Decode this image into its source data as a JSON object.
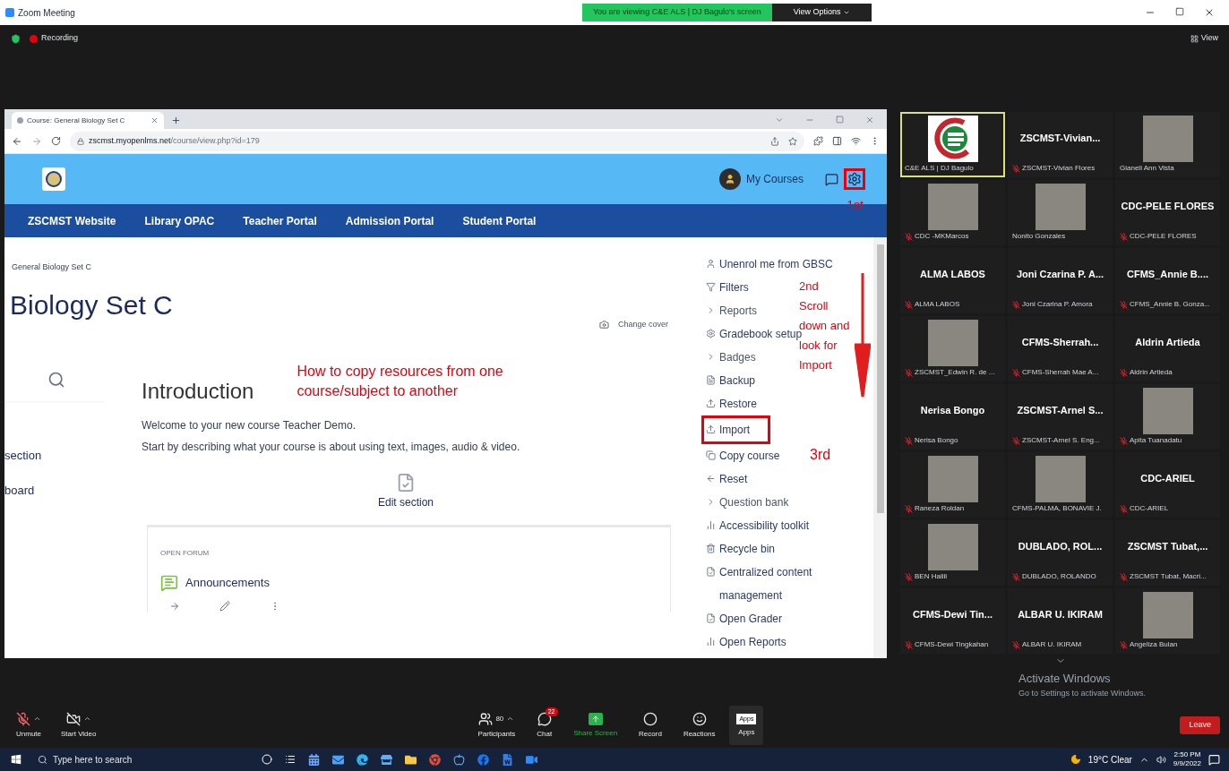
{
  "titlebar": {
    "title": "Zoom Meeting",
    "banner": "You are viewing C&E ALS | DJ Bagulo's screen",
    "view_options": "View Options"
  },
  "statusbar": {
    "recording": "Recording",
    "view": "View"
  },
  "browser": {
    "tab": "Course: General Biology Set C",
    "url_host": "zscmst.myopenlms.net",
    "url_path": "/course/view.php?id=179",
    "my_courses": "My Courses",
    "nav": [
      "ZSCMST Website",
      "Library OPAC",
      "Teacher Portal",
      "Admission Portal",
      "Student Portal"
    ],
    "breadcrumb": "General Biology Set C",
    "title": "Biology Set C",
    "change_cover": "Change cover",
    "left_links": [
      "section",
      "board"
    ],
    "section": {
      "heading": "Introduction",
      "text": [
        "Welcome to your new course Teacher Demo.",
        "Start by describing what your course is about using text, images, audio & video."
      ],
      "edit": "Edit section",
      "card_label": "OPEN FORUM",
      "activity": "Announcements"
    },
    "menu": [
      {
        "label": "Unenrol me from GBSC",
        "kind": "user",
        "highlighted": false
      },
      {
        "label": "Filters",
        "kind": "filter",
        "highlighted": false
      },
      {
        "label": "Reports",
        "kind": "chevron",
        "highlighted": false
      },
      {
        "label": "Gradebook setup",
        "kind": "gear",
        "highlighted": false
      },
      {
        "label": "Badges",
        "kind": "chevron",
        "highlighted": false
      },
      {
        "label": "Backup",
        "kind": "file",
        "highlighted": false
      },
      {
        "label": "Restore",
        "kind": "upload",
        "highlighted": false
      },
      {
        "label": "Import",
        "kind": "upload",
        "highlighted": true
      },
      {
        "label": "Copy course",
        "kind": "copy",
        "highlighted": false
      },
      {
        "label": "Reset",
        "kind": "back",
        "highlighted": false
      },
      {
        "label": "Question bank",
        "kind": "chevron",
        "highlighted": false
      },
      {
        "label": "Accessibility toolkit",
        "kind": "chart",
        "highlighted": false
      },
      {
        "label": "Recycle bin",
        "kind": "trash",
        "highlighted": false
      },
      {
        "label": "Centralized content management",
        "kind": "doc",
        "highlighted": false
      },
      {
        "label": "Open Grader",
        "kind": "doc",
        "highlighted": false
      },
      {
        "label": "Open Reports",
        "kind": "chart",
        "highlighted": false
      }
    ]
  },
  "annotations": {
    "step1": "1st",
    "step2": "2nd",
    "step2_text": "Scroll down and look for Import",
    "step3": "3rd",
    "title": "How to copy resources from one course/subject to another"
  },
  "gallery": [
    {
      "kind": "logo",
      "name": "C&E ALS | DJ Bagulo",
      "muted": false,
      "active": true
    },
    {
      "kind": "name",
      "label": "ZSCMST-Vivian...",
      "name": "ZSCMST-Vivian Flores",
      "muted": true,
      "active": false
    },
    {
      "kind": "photo",
      "name": "Gianeli Ann Vista",
      "muted": false,
      "active": false
    },
    {
      "kind": "photo",
      "name": "CDC -MKMarcos",
      "muted": true,
      "active": false
    },
    {
      "kind": "photo",
      "name": "Nonito Gonzales",
      "muted": false,
      "active": false
    },
    {
      "kind": "name",
      "label": "CDC-PELE FLORES",
      "name": "CDC-PELE FLORES",
      "muted": true,
      "active": false
    },
    {
      "kind": "name",
      "label": "ALMA LABOS",
      "name": "ALMA LABOS",
      "muted": true,
      "active": false
    },
    {
      "kind": "name",
      "label": "Joni Czarina P. A...",
      "name": "Joni Czarina P. Amora",
      "muted": true,
      "active": false
    },
    {
      "kind": "name",
      "label": "CFMS_Annie B....",
      "name": "CFMS_Annie B. Gonza...",
      "muted": true,
      "active": false
    },
    {
      "kind": "photo",
      "name": "ZSCMST_Edwin R. de ...",
      "muted": true,
      "active": false
    },
    {
      "kind": "name",
      "label": "CFMS-Sherrah...",
      "name": "CFMS-Sherrah Mae A...",
      "muted": true,
      "active": false
    },
    {
      "kind": "name",
      "label": "Aldrin Artieda",
      "name": "Aldrin Artieda",
      "muted": true,
      "active": false
    },
    {
      "kind": "name",
      "label": "Nerisa Bongo",
      "name": "Nerisa Bongo",
      "muted": true,
      "active": false
    },
    {
      "kind": "name",
      "label": "ZSCMST-Arnel S...",
      "name": "ZSCMST-Arnel S. Eng...",
      "muted": true,
      "active": false
    },
    {
      "kind": "photo",
      "name": "Apita Tuanadatu",
      "muted": true,
      "active": false
    },
    {
      "kind": "photo",
      "name": "Raneza Roldan",
      "muted": true,
      "active": false
    },
    {
      "kind": "photo",
      "name": "CFMS-PALMA, BONAVIE J.",
      "muted": false,
      "active": false
    },
    {
      "kind": "name",
      "label": "CDC-ARIEL",
      "name": "CDC-ARIEL",
      "muted": true,
      "active": false
    },
    {
      "kind": "photo",
      "name": "BEN Halili",
      "muted": true,
      "active": false
    },
    {
      "kind": "name",
      "label": "DUBLADO, ROL...",
      "name": "DUBLADO, ROLANDO",
      "muted": true,
      "active": false
    },
    {
      "kind": "name",
      "label": "ZSCMST Tubat,...",
      "name": "ZSCMST Tubat, Macri...",
      "muted": true,
      "active": false
    },
    {
      "kind": "name",
      "label": "CFMS-Dewi Tin...",
      "name": "CFMS-Dewi Tingkahan",
      "muted": true,
      "active": false
    },
    {
      "kind": "name",
      "label": "ALBAR U. IKIRAM",
      "name": "ALBAR U. IKIRAM",
      "muted": true,
      "active": false
    },
    {
      "kind": "photo",
      "name": "Angeliza Bulan",
      "muted": true,
      "active": false
    }
  ],
  "activation": {
    "title": "Activate Windows",
    "text": "Go to Settings to activate Windows."
  },
  "toolbar": [
    {
      "kind": "mic",
      "label": "Unmute"
    },
    {
      "kind": "video",
      "label": "Start Video"
    },
    {
      "kind": "participants",
      "label": "Participants",
      "count": "80"
    },
    {
      "kind": "chat",
      "label": "Chat",
      "count": "22"
    },
    {
      "kind": "share",
      "label": "Share Screen"
    },
    {
      "kind": "record",
      "label": "Record"
    },
    {
      "kind": "reactions",
      "label": "Reactions"
    },
    {
      "kind": "apps",
      "label": "Apps",
      "count": "Apps"
    }
  ],
  "leave": "Leave",
  "taskbar": {
    "search_placeholder": "Type here to search",
    "weather": "19°C Clear",
    "time": "2:50 PM",
    "date": "9/9/2022"
  }
}
